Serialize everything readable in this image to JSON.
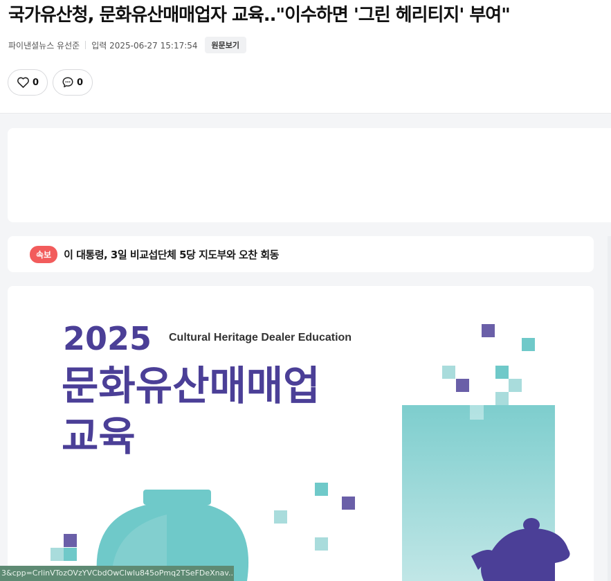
{
  "article": {
    "headline": "국가유산청, 문화유산매매업자 교육..\"이수하면 '그린 헤리티지' 부여\"",
    "source": "파이낸셜뉴스 유선준",
    "date_label": "입력 2025-06-27 15:17:54",
    "original_button": "원문보기"
  },
  "reactions": {
    "like_count": "0",
    "comment_count": "0"
  },
  "breaking": {
    "badge": "속보",
    "text": "이 대통령, 3일 비교섭단체 5당 지도부와 오찬 회동"
  },
  "poster": {
    "year": "2025",
    "subtitle_en": "Cultural Heritage Dealer Education",
    "title_line1": "문화유산매매업",
    "title_line2": "교육"
  },
  "status_url": "3&cpp=CrlinVTozOVzYVCbdOwClwlu845oPmq2TSeFDeXnav...",
  "colors": {
    "primary_purple": "#4b3f97",
    "teal": "#6fc9c9",
    "light_teal": "#a9dcdc",
    "badge_red": "#f25c5c",
    "status_green": "#5e8a73"
  },
  "icons": {
    "like": "heart-icon",
    "comment": "comment-icon"
  }
}
